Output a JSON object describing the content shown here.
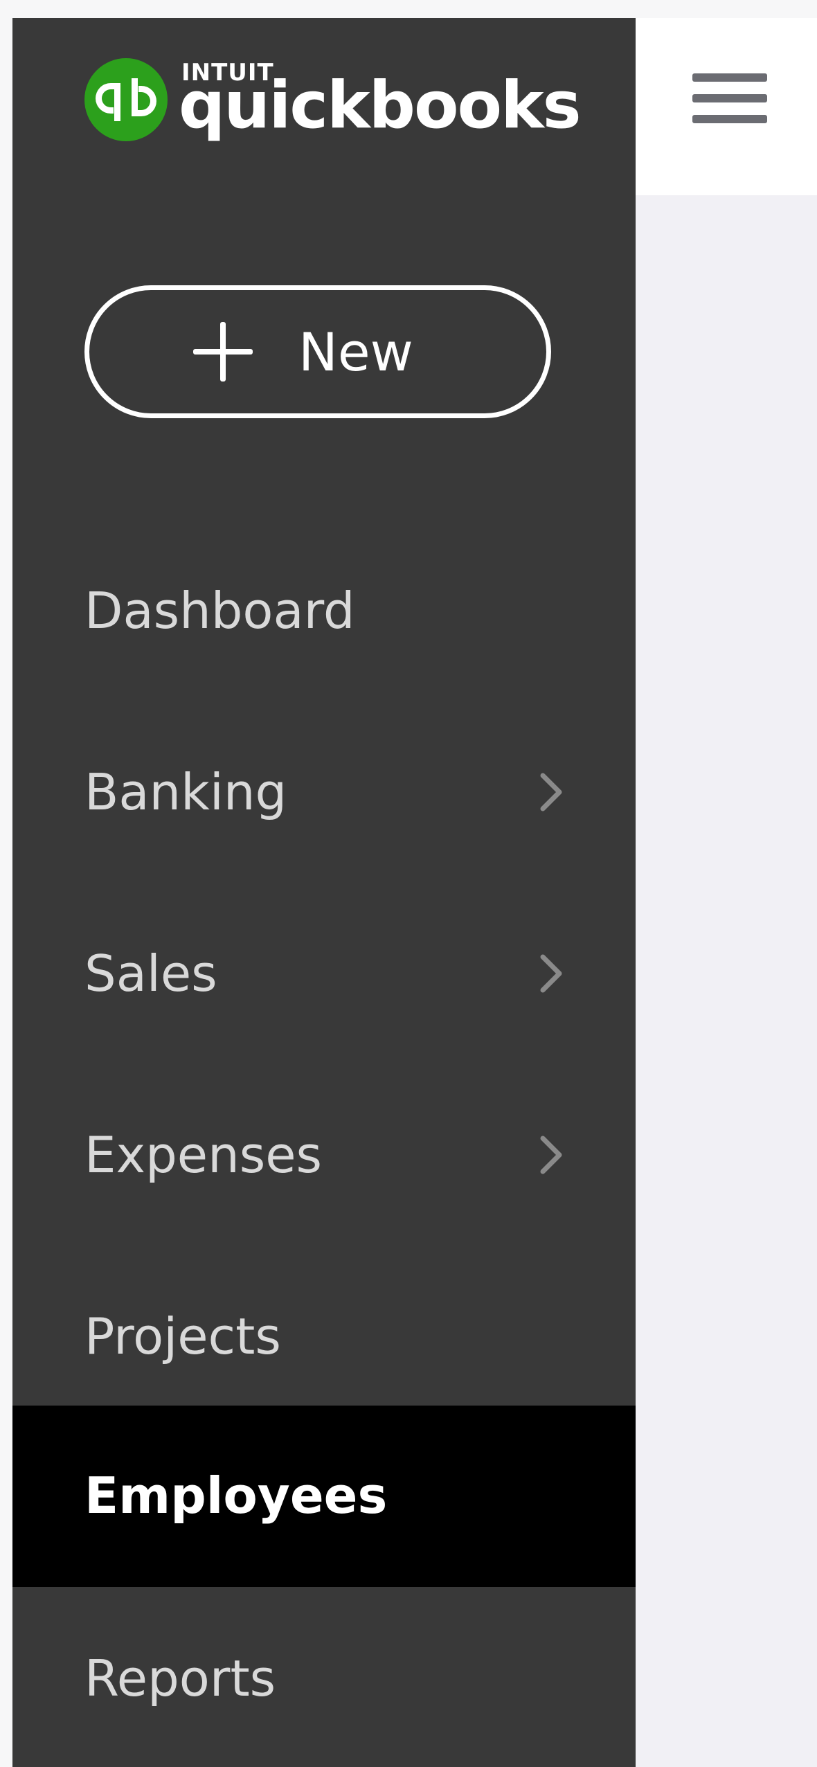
{
  "brand": {
    "intuit": "INTUIT",
    "product": "quickbooks",
    "logo_icon": "quickbooks-qb-icon",
    "colors": {
      "logo_green": "#2ca01c",
      "sidebar_bg": "#393939",
      "active_bg": "#000000",
      "content_bg": "#f1f0f5",
      "topbar_bg": "#ffffff"
    }
  },
  "new_button": {
    "icon": "plus-icon",
    "label": "New"
  },
  "topbar": {
    "menu_icon": "hamburger-menu-icon"
  },
  "nav": {
    "items": [
      {
        "label": "Dashboard",
        "has_chevron": false,
        "active": false
      },
      {
        "label": "Banking",
        "has_chevron": true,
        "active": false
      },
      {
        "label": "Sales",
        "has_chevron": true,
        "active": false
      },
      {
        "label": "Expenses",
        "has_chevron": true,
        "active": false
      },
      {
        "label": "Projects",
        "has_chevron": false,
        "active": false
      },
      {
        "label": "Employees",
        "has_chevron": false,
        "active": true
      },
      {
        "label": "Reports",
        "has_chevron": false,
        "active": false
      }
    ]
  }
}
